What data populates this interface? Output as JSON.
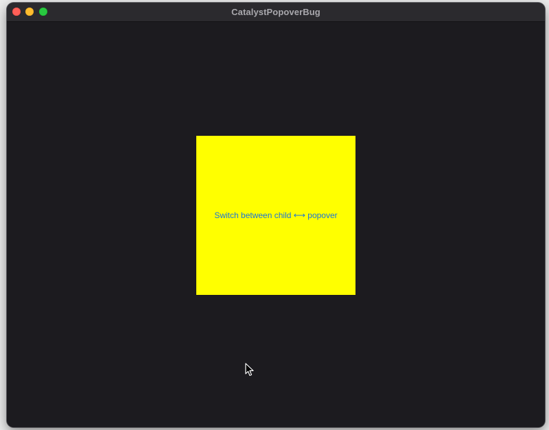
{
  "window": {
    "title": "CatalystPopoverBug",
    "traffic_lights": [
      "close",
      "minimize",
      "zoom"
    ]
  },
  "main": {
    "switch_button_label": "Switch between child ⟷ popover"
  },
  "colors": {
    "window_background": "#1c1b1f",
    "titlebar": "#2b2a2e",
    "panel": "#ffff00",
    "link": "#1a74d9"
  },
  "icons": {
    "cursor": "arrow-cursor-icon"
  }
}
